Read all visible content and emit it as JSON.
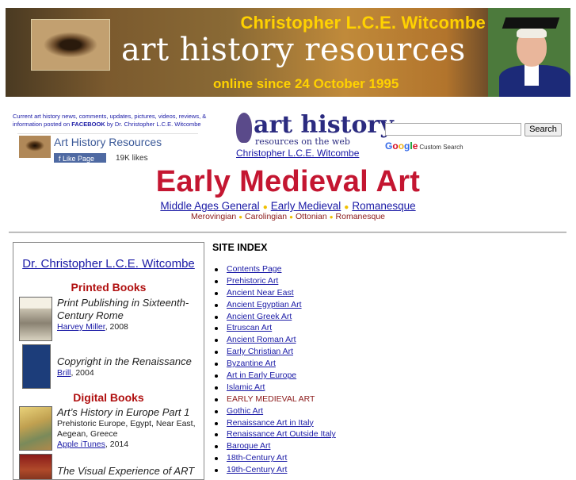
{
  "banner": {
    "name": "Christopher L.C.E. Witcombe",
    "title": "art history resources",
    "since": "online since 24 October 1995"
  },
  "facebook": {
    "note_before": "Current art history news, comments, updates, pictures, videos, reviews, & information posted on ",
    "note_link": "FACEBOOK",
    "note_after": " by Dr. Christopher L.C.E. Witcombe",
    "page_name": "Art History Resources",
    "like_label": "Like Page",
    "likes": "19K likes"
  },
  "logo": {
    "big": "art history",
    "small": "resources on the web",
    "author": "Christopher L.C.E. Witcombe"
  },
  "search": {
    "button": "Search",
    "google": [
      "G",
      "o",
      "o",
      "g",
      "l",
      "e"
    ],
    "google_colors": [
      "#3369e8",
      "#d50f25",
      "#eeb211",
      "#3369e8",
      "#009925",
      "#d50f25"
    ],
    "custom": "Custom Search"
  },
  "page": {
    "title": "Early Medieval Art",
    "nav": [
      "Middle Ages General",
      "Early Medieval",
      "Romanesque"
    ],
    "subnav": [
      "Merovingian",
      "Carolingian",
      "Ottonian",
      "Romanesque"
    ]
  },
  "books": {
    "author": "Dr. Christopher L.C.E. Witcombe",
    "printed_heading": "Printed Books",
    "digital_heading": "Digital Books",
    "printed": [
      {
        "title": "Print Publishing in Sixteenth-Century Rome",
        "publisher": "Harvey Miller",
        "year": ", 2008"
      },
      {
        "title": "Copyright in the Renaissance",
        "publisher": "Brill",
        "year": ", 2004"
      }
    ],
    "digital": [
      {
        "title": "Art’s History in Europe Part 1",
        "desc": "Prehistoric Europe, Egypt, Near East, Aegean, Greece",
        "publisher": "Apple iTunes",
        "year": ", 2014"
      },
      {
        "title": "The Visual Experience of ART"
      }
    ]
  },
  "site_index": {
    "heading": "SITE INDEX",
    "items": [
      "Contents Page",
      "Prehistoric Art",
      "Ancient Near East",
      "Ancient Egyptian Art",
      "Ancient Greek Art",
      "Etruscan Art",
      "Ancient Roman Art",
      "Early Christian Art",
      "Byzantine Art",
      "Art in Early Europe",
      "Islamic Art",
      "EARLY MEDIEVAL ART",
      "Gothic Art",
      "Renaissance Art in Italy",
      "Renaissance Art Outside Italy",
      "Baroque Art",
      "18th-Century Art",
      "19th-Century Art"
    ],
    "current": "EARLY MEDIEVAL ART"
  },
  "colors": {
    "title_red": "#c41631",
    "link_blue": "#1a1aa6",
    "banner_gold": "#ffd200",
    "subnav_red": "#8b1a1a",
    "section_red": "#b01010"
  }
}
